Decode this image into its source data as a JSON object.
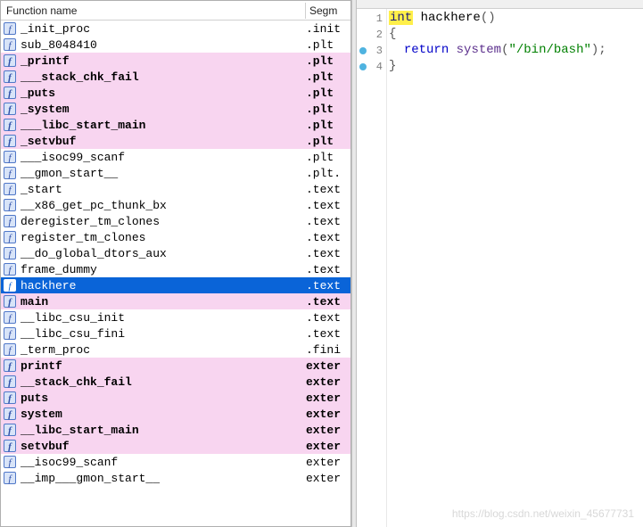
{
  "header": {
    "col_name": "Function name",
    "col_seg": "Segm"
  },
  "functions": [
    {
      "name": "_init_proc",
      "seg": ".init",
      "pink": false,
      "selected": false
    },
    {
      "name": "sub_8048410",
      "seg": ".plt",
      "pink": false,
      "selected": false
    },
    {
      "name": "_printf",
      "seg": ".plt",
      "pink": true,
      "selected": false
    },
    {
      "name": "___stack_chk_fail",
      "seg": ".plt",
      "pink": true,
      "selected": false
    },
    {
      "name": "_puts",
      "seg": ".plt",
      "pink": true,
      "selected": false
    },
    {
      "name": "_system",
      "seg": ".plt",
      "pink": true,
      "selected": false
    },
    {
      "name": "___libc_start_main",
      "seg": ".plt",
      "pink": true,
      "selected": false
    },
    {
      "name": "_setvbuf",
      "seg": ".plt",
      "pink": true,
      "selected": false
    },
    {
      "name": "___isoc99_scanf",
      "seg": ".plt",
      "pink": false,
      "selected": false
    },
    {
      "name": "__gmon_start__",
      "seg": ".plt.",
      "pink": false,
      "selected": false
    },
    {
      "name": "_start",
      "seg": ".text",
      "pink": false,
      "selected": false
    },
    {
      "name": "__x86_get_pc_thunk_bx",
      "seg": ".text",
      "pink": false,
      "selected": false
    },
    {
      "name": "deregister_tm_clones",
      "seg": ".text",
      "pink": false,
      "selected": false
    },
    {
      "name": "register_tm_clones",
      "seg": ".text",
      "pink": false,
      "selected": false
    },
    {
      "name": "__do_global_dtors_aux",
      "seg": ".text",
      "pink": false,
      "selected": false
    },
    {
      "name": "frame_dummy",
      "seg": ".text",
      "pink": false,
      "selected": false
    },
    {
      "name": "hackhere",
      "seg": ".text",
      "pink": false,
      "selected": true
    },
    {
      "name": "main",
      "seg": ".text",
      "pink": true,
      "selected": false
    },
    {
      "name": "__libc_csu_init",
      "seg": ".text",
      "pink": false,
      "selected": false
    },
    {
      "name": "__libc_csu_fini",
      "seg": ".text",
      "pink": false,
      "selected": false
    },
    {
      "name": "_term_proc",
      "seg": ".fini",
      "pink": false,
      "selected": false
    },
    {
      "name": "printf",
      "seg": "exter",
      "pink": true,
      "selected": false
    },
    {
      "name": "__stack_chk_fail",
      "seg": "exter",
      "pink": true,
      "selected": false
    },
    {
      "name": "puts",
      "seg": "exter",
      "pink": true,
      "selected": false
    },
    {
      "name": "system",
      "seg": "exter",
      "pink": true,
      "selected": false
    },
    {
      "name": "__libc_start_main",
      "seg": "exter",
      "pink": true,
      "selected": false
    },
    {
      "name": "setvbuf",
      "seg": "exter",
      "pink": true,
      "selected": false
    },
    {
      "name": "__isoc99_scanf",
      "seg": "exter",
      "pink": false,
      "selected": false
    },
    {
      "name": "__imp___gmon_start__",
      "seg": "exter",
      "pink": false,
      "selected": false
    }
  ],
  "code": {
    "lines": [
      {
        "n": 1,
        "bp": false,
        "tokens": [
          {
            "cls": "kw-int",
            "t": "int"
          },
          {
            "cls": "",
            "t": " "
          },
          {
            "cls": "kw-name",
            "t": "hackhere"
          },
          {
            "cls": "",
            "t": "()"
          }
        ]
      },
      {
        "n": 2,
        "bp": false,
        "tokens": [
          {
            "cls": "brace",
            "t": "{"
          }
        ]
      },
      {
        "n": 3,
        "bp": true,
        "tokens": [
          {
            "cls": "",
            "t": "  "
          },
          {
            "cls": "kw-return",
            "t": "return"
          },
          {
            "cls": "",
            "t": " "
          },
          {
            "cls": "kw-func",
            "t": "system"
          },
          {
            "cls": "",
            "t": "("
          },
          {
            "cls": "kw-str",
            "t": "\"/bin/bash\""
          },
          {
            "cls": "",
            "t": ");"
          }
        ]
      },
      {
        "n": 4,
        "bp": true,
        "tokens": [
          {
            "cls": "brace",
            "t": "}"
          }
        ]
      }
    ]
  },
  "watermark": "https://blog.csdn.net/weixin_45677731"
}
